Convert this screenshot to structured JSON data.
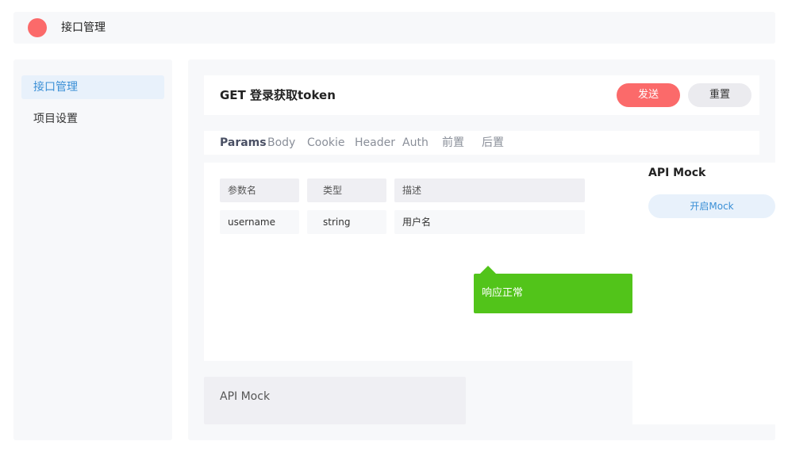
{
  "header": {
    "title": "接口管理",
    "logo_color": "#fb6a6a"
  },
  "sidebar": {
    "items": [
      {
        "label": "接口管理",
        "active": true
      },
      {
        "label": "项目设置",
        "active": false
      }
    ]
  },
  "request": {
    "method": "GET",
    "title": "GET 登录获取token",
    "send_label": "发送",
    "reset_label": "重置"
  },
  "tabs": [
    {
      "label": "Params",
      "active": true
    },
    {
      "label": "Body"
    },
    {
      "label": "Cookie"
    },
    {
      "label": "Header"
    },
    {
      "label": "Auth"
    },
    {
      "label": "前置"
    },
    {
      "label": "后置"
    }
  ],
  "params_table": {
    "headers": [
      "参数名",
      "类型",
      "描述"
    ],
    "rows": [
      [
        "username",
        "string",
        "用户名"
      ]
    ]
  },
  "toast": {
    "text": "响应正常",
    "color": "#52c41a"
  },
  "mock_box": {
    "label": "API Mock"
  },
  "mock_panel": {
    "title": "API Mock",
    "button_label": "开启Mock"
  },
  "colors": {
    "accent": "#fb6a6a",
    "link": "#3a8fd6",
    "success": "#52c41a"
  }
}
